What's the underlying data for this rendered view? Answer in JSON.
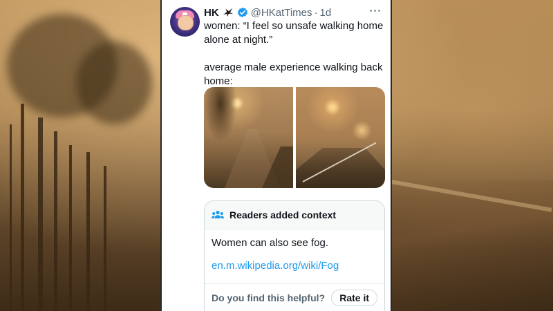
{
  "tweet": {
    "display_name": "HK",
    "handle": "@HKatTimes",
    "separator": "·",
    "time": "1d",
    "text": "women: “I feel so unsafe walking home alone at night.”\n\naverage male experience walking back home:",
    "media_count": 2
  },
  "community_note": {
    "title": "Readers added context",
    "body": "Women can also see fog.",
    "link": "en.m.wikipedia.org/wiki/Fog",
    "helpful_prompt": "Do you find this helpful?",
    "rate_label": "Rate it"
  },
  "icons": {
    "verified": "verified-badge-icon",
    "affiliate": "bird-emblem-icon",
    "more": "more-options-icon",
    "notes": "people-icon"
  },
  "colors": {
    "link": "#1d9bf0",
    "verified": "#1d9bf0",
    "text": "#0f1419",
    "muted": "#536471"
  }
}
